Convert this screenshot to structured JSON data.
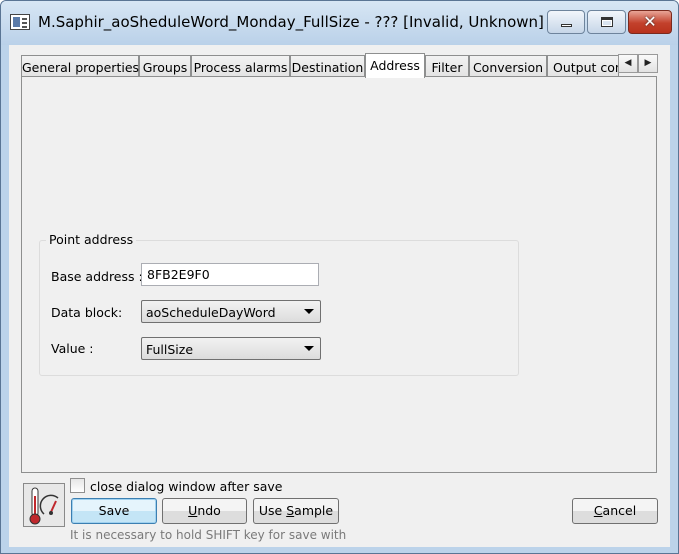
{
  "window": {
    "title": "M.Saphir_aoSheduleWord_Monday_FullSize - ??? [Invalid, Unknown] - B.SAP...",
    "controls": [
      "minimize-icon",
      "maximize-icon",
      "close-icon"
    ]
  },
  "tabs": [
    {
      "label": "General properties",
      "active": false
    },
    {
      "label": "Groups",
      "active": false
    },
    {
      "label": "Process alarms",
      "active": false
    },
    {
      "label": "Destination",
      "active": false
    },
    {
      "label": "Address",
      "active": true
    },
    {
      "label": "Filter",
      "active": false
    },
    {
      "label": "Conversion",
      "active": false
    },
    {
      "label": "Output cont",
      "active": false
    }
  ],
  "tab_scroll": {
    "left": "◀",
    "right": "▶"
  },
  "point_address": {
    "group_title": "Point address",
    "base_address_label": "Base address :",
    "base_address_value": "8FB2E9F0",
    "data_block_label": "Data block:",
    "data_block_value": "aoScheduleDayWord",
    "value_label": "Value  :",
    "value_value": "FullSize"
  },
  "footer": {
    "checkbox_label": "close dialog window after save",
    "checkbox_checked": false,
    "save": "Save",
    "undo_mnemonic": "U",
    "undo_rest": "ndo",
    "use_sample_prefix": "Use ",
    "use_sample_mnemonic": "S",
    "use_sample_rest": "ample",
    "cancel_mnemonic": "C",
    "cancel_rest": "ancel",
    "hint": "It is necessary to hold SHIFT key for save with"
  }
}
